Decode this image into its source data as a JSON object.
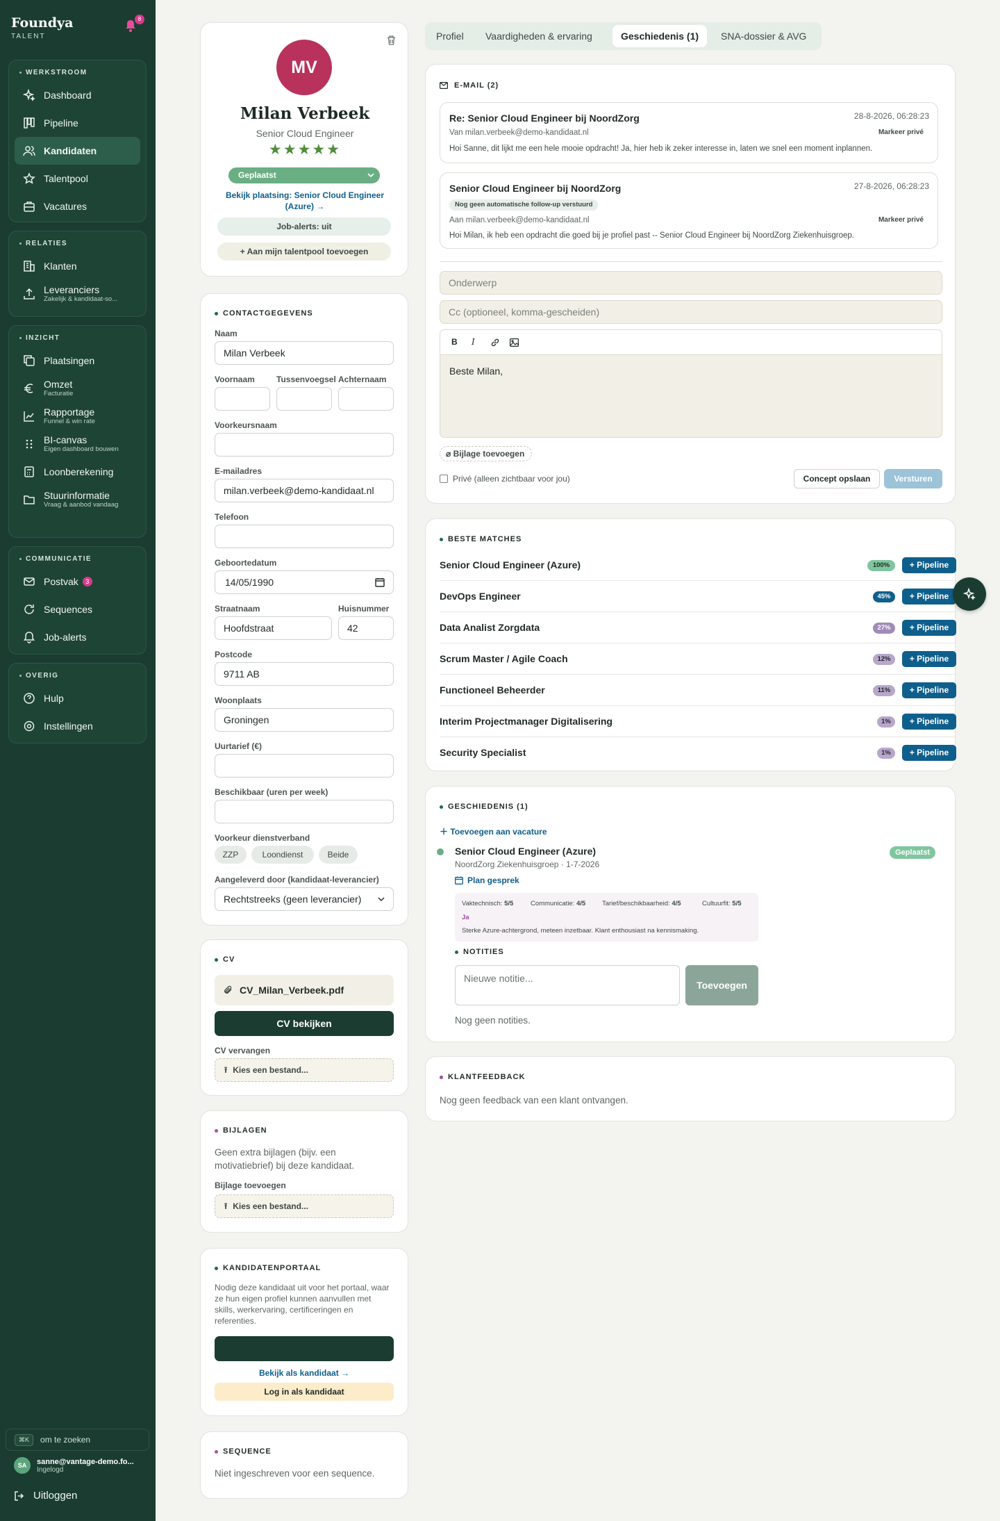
{
  "brand": {
    "name": "Foundya",
    "sub": "TALENT",
    "notif_count": "8"
  },
  "nav": {
    "werkstroom": {
      "title": "WERKSTROOM",
      "items": [
        {
          "label": "Dashboard"
        },
        {
          "label": "Pipeline"
        },
        {
          "label": "Kandidaten"
        },
        {
          "label": "Talentpool"
        },
        {
          "label": "Vacatures"
        }
      ]
    },
    "relaties": {
      "title": "RELATIES",
      "items": [
        {
          "label": "Klanten"
        },
        {
          "label": "Leveranciers",
          "sub": "Zakelijk & kandidaat-so..."
        }
      ]
    },
    "inzicht": {
      "title": "INZICHT",
      "items": [
        {
          "label": "Plaatsingen"
        },
        {
          "label": "Omzet",
          "sub": "Facturatie"
        },
        {
          "label": "Rapportage",
          "sub": "Funnel & win rate"
        },
        {
          "label": "BI-canvas",
          "sub": "Eigen dashboard bouwen"
        },
        {
          "label": "Loonberekening"
        },
        {
          "label": "Stuurinformatie",
          "sub": "Vraag & aanbod vandaag"
        }
      ]
    },
    "communicatie": {
      "title": "COMMUNICATIE",
      "items": [
        {
          "label": "Postvak",
          "badge": "3"
        },
        {
          "label": "Sequences"
        },
        {
          "label": "Job-alerts"
        }
      ]
    },
    "overig": {
      "title": "OVERIG",
      "items": [
        {
          "label": "Hulp"
        },
        {
          "label": "Instellingen"
        }
      ]
    }
  },
  "search": {
    "kbd": "⌘K",
    "label": "om te zoeken"
  },
  "user": {
    "initials": "SA",
    "email": "sanne@vantage-demo.fo...",
    "status": "Ingelogd",
    "logout": "Uitloggen"
  },
  "profile": {
    "initials": "MV",
    "name": "Milan Verbeek",
    "title": "Senior Cloud Engineer",
    "rating": 5,
    "stars": "★★★★★",
    "status": "Geplaatst",
    "placement_link": "Bekijk plaatsing: Senior Cloud Engineer (Azure) →",
    "job_alerts": "Job-alerts: uit",
    "talentpool": "+ Aan mijn talentpool toevoegen"
  },
  "contact": {
    "title": "CONTACTGEGEVENS",
    "naam_label": "Naam",
    "naam": "Milan Verbeek",
    "voornaam_label": "Voornaam",
    "tussenvoegsel_label": "Tussenvoegsel",
    "achternaam_label": "Achternaam",
    "voorkeursnaam_label": "Voorkeursnaam",
    "email_label": "E-mailadres",
    "email": "milan.verbeek@demo-kandidaat.nl",
    "telefoon_label": "Telefoon",
    "geboortedatum_label": "Geboortedatum",
    "geboortedatum": "14/05/1990",
    "straat_label": "Straatnaam",
    "straat": "Hoofdstraat",
    "huisnummer_label": "Huisnummer",
    "huisnummer": "42",
    "postcode_label": "Postcode",
    "postcode": "9711 AB",
    "woonplaats_label": "Woonplaats",
    "woonplaats": "Groningen",
    "uurtarief_label": "Uurtarief (€)",
    "beschikbaar_label": "Beschikbaar (uren per week)",
    "dienstverband_label": "Voorkeur dienstverband",
    "dienstverband": [
      "ZZP",
      "Loondienst",
      "Beide"
    ],
    "aangeleverd_label": "Aangeleverd door (kandidaat-leverancier)",
    "aangeleverd": "Rechtstreeks (geen leverancier)"
  },
  "cv": {
    "title": "CV",
    "file": "CV_Milan_Verbeek.pdf",
    "view": "CV bekijken",
    "replace_label": "CV vervangen",
    "choose": "Kies een bestand..."
  },
  "bijlagen": {
    "title": "BIJLAGEN",
    "text": "Geen extra bijlagen (bijv. een motivatiebrief) bij deze kandidaat.",
    "add_label": "Bijlage toevoegen",
    "choose": "Kies een bestand..."
  },
  "portaal": {
    "title": "KANDIDATENPORTAAL",
    "text": "Nodig deze kandidaat uit voor het portaal, waar ze hun eigen profiel kunnen aanvullen met skills, werkervaring, certificeringen en referenties.",
    "view_link": "Bekijk als kandidaat →",
    "login": "Log in als kandidaat"
  },
  "sequence": {
    "title": "SEQUENCE",
    "text": "Niet ingeschreven voor een sequence."
  },
  "tabs": [
    {
      "label": "Profiel"
    },
    {
      "label": "Vaardigheden & ervaring"
    },
    {
      "label": "Geschiedenis (1)"
    },
    {
      "label": "SNA-dossier & AVG"
    }
  ],
  "email": {
    "title": "E-MAIL (2)",
    "messages": [
      {
        "subject": "Re: Senior Cloud Engineer bij NoordZorg",
        "date": "28-8-2026, 06:28:23",
        "from": "Van milan.verbeek@demo-kandidaat.nl",
        "private": "Markeer privé",
        "body": "Hoi Sanne, dit lijkt me een hele mooie opdracht! Ja, hier heb ik zeker interesse in, laten we snel een moment inplannen."
      },
      {
        "subject": "Senior Cloud Engineer bij NoordZorg",
        "date": "27-8-2026, 06:28:23",
        "tag": "Nog geen automatische follow-up verstuurd",
        "from": "Aan milan.verbeek@demo-kandidaat.nl",
        "private": "Markeer privé",
        "body": "Hoi Milan, ik heb een opdracht die goed bij je profiel past -- Senior Cloud Engineer bij NoordZorg Ziekenhuisgroep."
      }
    ],
    "subject_ph": "Onderwerp",
    "cc_ph": "Cc (optioneel, komma-gescheiden)",
    "body": "Beste Milan,",
    "attach": "Bijlage toevoegen",
    "private": "Privé (alleen zichtbaar voor jou)",
    "draft": "Concept opslaan",
    "send": "Versturen"
  },
  "matches": {
    "title": "BESTE MATCHES",
    "pipeline_label": "+ Pipeline",
    "items": [
      {
        "name": "Senior Cloud Engineer (Azure)",
        "pct": "100%",
        "color": "#7fc69e"
      },
      {
        "name": "DevOps Engineer",
        "pct": "45%",
        "color": "#0f5f8c"
      },
      {
        "name": "Data Analist Zorgdata",
        "pct": "27%",
        "color": "#a28bb8"
      },
      {
        "name": "Scrum Master / Agile Coach",
        "pct": "12%",
        "color": "#b9a6cc"
      },
      {
        "name": "Functioneel Beheerder",
        "pct": "11%",
        "color": "#b9a6cc"
      },
      {
        "name": "Interim Projectmanager Digitalisering",
        "pct": "1%",
        "color": "#b9a6cc"
      },
      {
        "name": "Security Specialist",
        "pct": "1%",
        "color": "#b9a6cc"
      }
    ]
  },
  "history": {
    "title": "GESCHIEDENIS (1)",
    "add": "Toevoegen aan vacature",
    "item": {
      "title": "Senior Cloud Engineer (Azure)",
      "meta": "NoordZorg Ziekenhuisgroep · 1-7-2026",
      "status": "Geplaatst",
      "plan": "Plan gesprek",
      "scores": [
        {
          "label": "Vaktechnisch:",
          "value": "5/5"
        },
        {
          "label": "Communicatie:",
          "value": "4/5"
        },
        {
          "label": "Tarief/beschikbaarheid:",
          "value": "4/5"
        },
        {
          "label": "Cultuurfit:",
          "value": "5/5"
        }
      ],
      "verdict": "Ja",
      "remark": "Sterke Azure-achtergrond, meteen inzetbaar. Klant enthousiast na kennismaking."
    },
    "notes_title": "NOTITIES",
    "note_ph": "Nieuwe notitie...",
    "note_add": "Toevoegen",
    "no_notes": "Nog geen notities."
  },
  "feedback": {
    "title": "KLANTFEEDBACK",
    "text": "Nog geen feedback van een klant ontvangen."
  },
  "colors": {
    "sidebar": "#1b3d31",
    "accent": "#0f5f8c",
    "avatar": "#b8325c",
    "status_green": "#7fc69e"
  }
}
